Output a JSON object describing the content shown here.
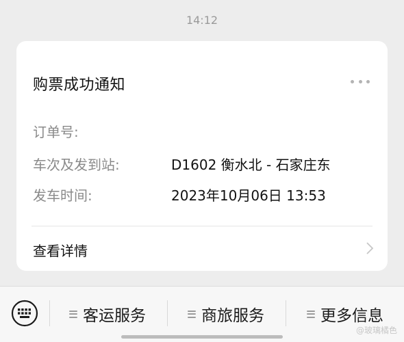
{
  "timestamp": "14:12",
  "card": {
    "title": "购票成功通知",
    "fields": [
      {
        "label": "订单号:",
        "value": ""
      },
      {
        "label": "车次及发到站:",
        "value": "D1602  衡水北 - 石家庄东"
      },
      {
        "label": "发车时间:",
        "value": "2023年10月06日 13:53"
      }
    ],
    "detail_link": "查看详情"
  },
  "bottom_menu": {
    "items": [
      {
        "label": "客运服务",
        "icon": "list-icon"
      },
      {
        "label": "商旅服务",
        "icon": "list-icon"
      },
      {
        "label": "更多信息",
        "icon": "list-icon"
      }
    ]
  },
  "watermark": "@玻璃橘色"
}
